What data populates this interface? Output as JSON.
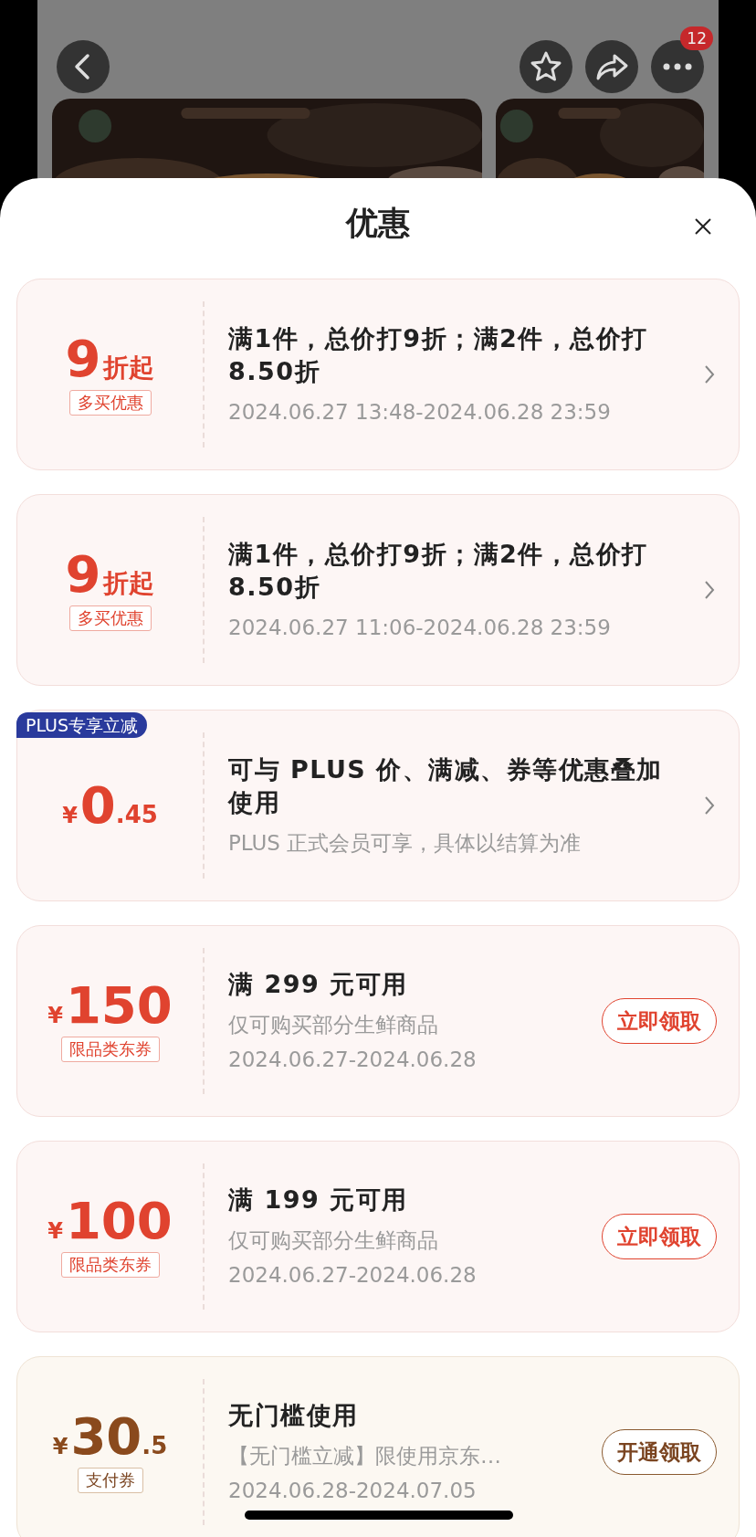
{
  "top_bar": {
    "badge": "12"
  },
  "sheet": {
    "title": "优惠"
  },
  "offers": [
    {
      "kind": "discount",
      "amount": {
        "main": "9",
        "suffix": "折起"
      },
      "tag": "多买优惠",
      "title": "满1件，总价打9折；满2件，总价打8.50折",
      "lines": [
        "2024.06.27 13:48-2024.06.28 23:59"
      ],
      "action": {
        "kind": "chevron"
      }
    },
    {
      "kind": "discount",
      "amount": {
        "main": "9",
        "suffix": "折起"
      },
      "tag": "多买优惠",
      "title": "满1件，总价打9折；满2件，总价打8.50折",
      "lines": [
        "2024.06.27 11:06-2024.06.28 23:59"
      ],
      "action": {
        "kind": "chevron"
      }
    },
    {
      "kind": "plus",
      "badge": "PLUS专享立减",
      "amount": {
        "prefix": "¥",
        "main": "0",
        "suffix": ".45"
      },
      "title": "可与 PLUS 价、满减、券等优惠叠加使用",
      "lines": [
        "PLUS 正式会员可享，具体以结算为准"
      ],
      "action": {
        "kind": "chevron"
      }
    },
    {
      "kind": "coupon",
      "amount": {
        "prefix": "¥",
        "main": "150"
      },
      "tag": "限品类东券",
      "title": "满 299 元可用",
      "lines": [
        "仅可购买部分生鲜商品",
        "2024.06.27-2024.06.28"
      ],
      "action": {
        "kind": "button",
        "label": "立即领取"
      }
    },
    {
      "kind": "coupon",
      "amount": {
        "prefix": "¥",
        "main": "100"
      },
      "tag": "限品类东券",
      "title": "满 199 元可用",
      "lines": [
        "仅可购买部分生鲜商品",
        "2024.06.27-2024.06.28"
      ],
      "action": {
        "kind": "button",
        "label": "立即领取"
      }
    },
    {
      "kind": "pay",
      "amount": {
        "prefix": "¥",
        "main": "30",
        "suffix": ".5"
      },
      "tag": "支付券",
      "title": "无门槛使用",
      "lines": [
        "【无门槛立减】限使用京东…",
        "2024.06.28-2024.07.05"
      ],
      "action": {
        "kind": "button",
        "label": "开通领取"
      }
    }
  ]
}
